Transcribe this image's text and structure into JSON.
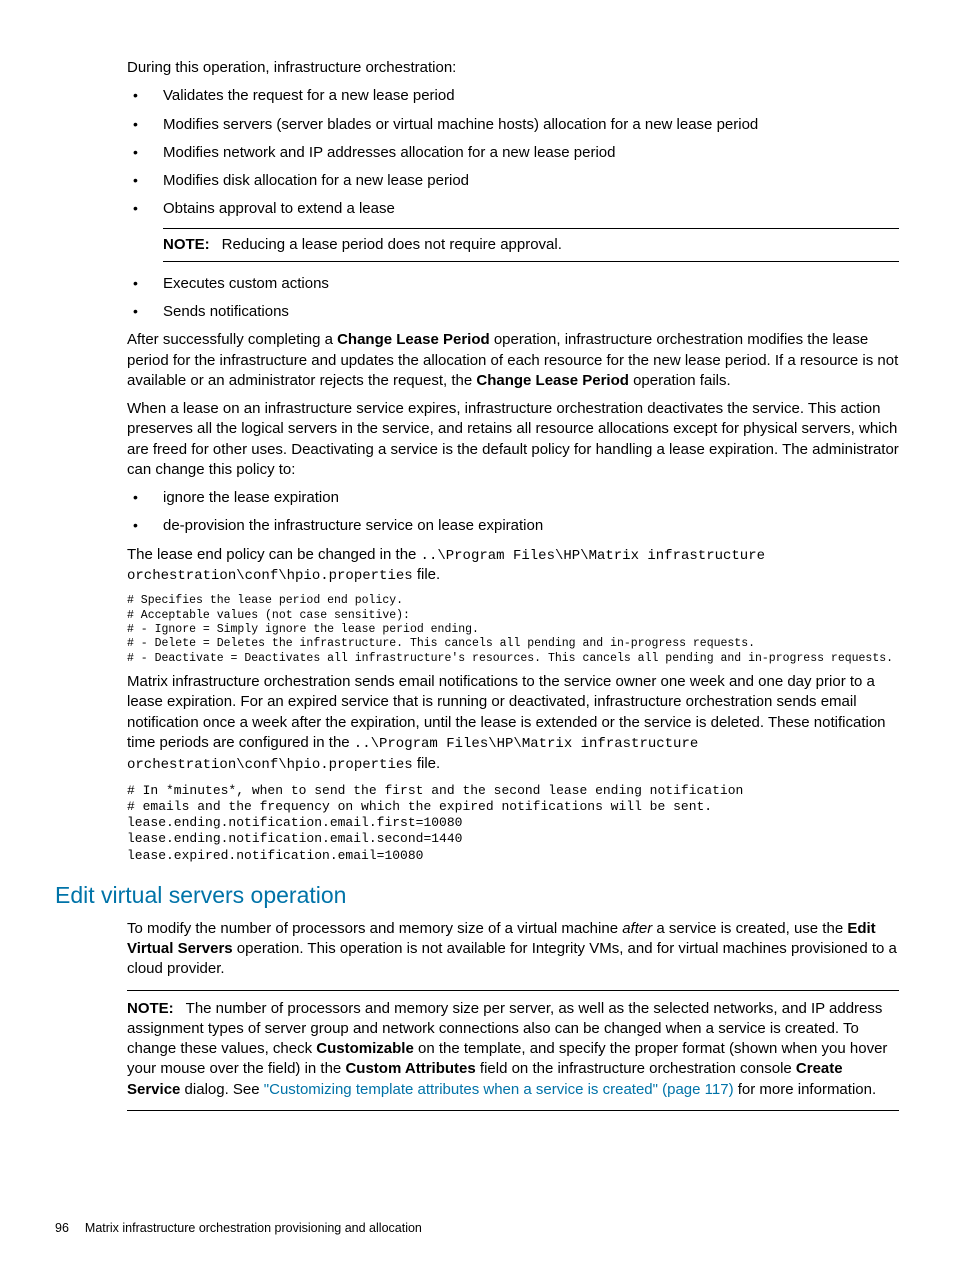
{
  "intro": "During this operation, infrastructure orchestration:",
  "bullets1": [
    "Validates the request for a new lease period",
    "Modifies servers (server blades or virtual machine hosts) allocation for a new lease period",
    "Modifies network and IP addresses allocation for a new lease period",
    "Modifies disk allocation for a new lease period",
    "Obtains approval to extend a lease"
  ],
  "note1": {
    "label": "NOTE:",
    "text": "Reducing a lease period does not require approval."
  },
  "bullets2": [
    "Executes custom actions",
    "Sends notifications"
  ],
  "para_after": {
    "pre1": "After successfully completing a ",
    "bold1": "Change Lease Period",
    "mid1": " operation, infrastructure orchestration modifies the lease period for the infrastructure and updates the allocation of each resource for the new lease period. If a resource is not available or an administrator rejects the request, the ",
    "bold2": "Change Lease Period",
    "post1": " operation fails."
  },
  "para_expire": "When a lease on an infrastructure service expires, infrastructure orchestration deactivates the service. This action preserves all the logical servers in the service, and retains all resource allocations except for physical servers, which are freed for other uses. Deactivating a service is the default policy for handling a lease expiration. The administrator can change this policy to:",
  "bullets3": [
    "ignore the lease expiration",
    "de-provision the infrastructure service on lease expiration"
  ],
  "para_policy": {
    "pre": "The lease end policy can be changed in the ",
    "code": "..\\Program Files\\HP\\Matrix infrastructure orchestration\\conf\\hpio.properties",
    "post": " file."
  },
  "code1": "# Specifies the lease period end policy.\n# Acceptable values (not case sensitive):\n# - Ignore = Simply ignore the lease period ending.\n# - Delete = Deletes the infrastructure. This cancels all pending and in-progress requests.\n# - Deactivate = Deactivates all infrastructure's resources. This cancels all pending and in-progress requests.",
  "para_email": {
    "pre": "Matrix infrastructure orchestration sends email notifications to the service owner one week and one day prior to a lease expiration. For an expired service that is running or deactivated, infrastructure orchestration sends email notification once a week after the expiration, until the lease is extended or the service is deleted. These notification time periods are configured in the ",
    "code": "..\\Program Files\\HP\\Matrix infrastructure orchestration\\conf\\hpio.properties",
    "post": " file."
  },
  "code2": "# In *minutes*, when to send the first and the second lease ending notification\n# emails and the frequency on which the expired notifications will be sent.\nlease.ending.notification.email.first=10080\nlease.ending.notification.email.second=1440\nlease.expired.notification.email=10080",
  "section_heading": "Edit virtual servers operation",
  "para_edit": {
    "pre": "To modify the number of processors and memory size of a virtual machine ",
    "italic": "after",
    "mid": " a service is created, use the ",
    "bold": "Edit Virtual Servers",
    "post": " operation. This operation is not available for Integrity VMs, and for virtual machines provisioned to a cloud provider."
  },
  "note2": {
    "label": "NOTE:",
    "pre": "The number of processors and memory size per server, as well as the selected networks, and IP address assignment types of server group and network connections also can be changed when a service is created. To change these values, check ",
    "bold1": "Customizable",
    "mid1": " on the template, and specify the proper format (shown when you hover your mouse over the field) in the ",
    "bold2": "Custom Attributes",
    "mid2": " field on the infrastructure orchestration console ",
    "bold3": "Create Service",
    "mid3": " dialog. See ",
    "link": "\"Customizing template attributes when a service is created\" (page 117)",
    "post": " for more information."
  },
  "footer": {
    "page": "96",
    "title": "Matrix infrastructure orchestration provisioning and allocation"
  }
}
